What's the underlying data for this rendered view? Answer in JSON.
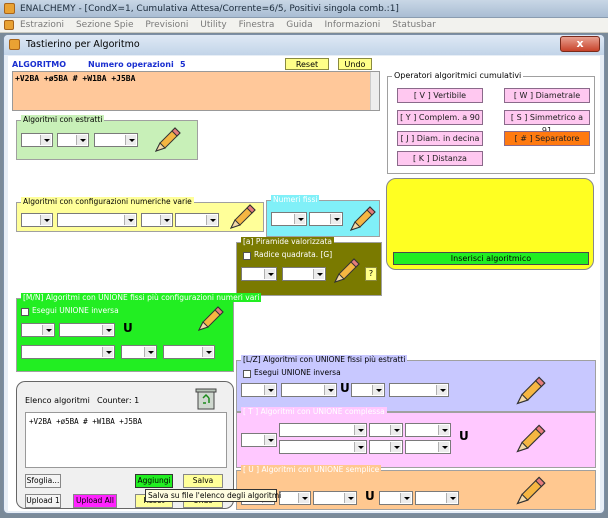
{
  "window": {
    "title": "ENALCHEMY - [CondX=1, Cumulativa Attesa/Corrente=6/5, Positivi singola comb.:1]",
    "menu": [
      "Estrazioni",
      "Sezione Spie",
      "Previsioni",
      "Utility",
      "Finestra",
      "Guida",
      "Informazioni",
      "Statusbar"
    ]
  },
  "dialog": {
    "title": "Tastierino per Algoritmo",
    "close_glyph": "x"
  },
  "algorithm": {
    "label": "ALGORITMO",
    "ops_label": "Numero operazioni",
    "ops_count": "5",
    "reset_label": "Reset",
    "undo_label": "Undo",
    "formula": "+V2BA +ø5BA # +W1BA +J5BA"
  },
  "operators": {
    "title": "Operatori algoritmici cumulativi",
    "buttons": [
      "[ V ] Vertibile",
      "[ W ] Diametrale",
      "[ Y ] Complem. a 90",
      "[ S ] Simmetrico  a 91",
      "[ J ] Diam. in decina",
      "[ # ] Separatore",
      "[ K ] Distanza"
    ]
  },
  "sections": {
    "estratti": "Algoritmi con estratti",
    "config": "Algoritmi con configurazioni numeriche varie",
    "fissi": "Numeri fissi",
    "piramide": "[a] Piramide valorizzata",
    "radice": "Radice quadrata. [G]",
    "question": "?",
    "mn": "[M/N] Algoritmi con UNIONE fissi più configurazioni numeri vari",
    "mn_check": "Esegui UNIONE inversa",
    "lz": "[L/Z] Algoritmi con UNIONE fissi più estratti",
    "lz_check": "Esegui UNIONE inversa",
    "t": "[ T ] Algoritmi con UNIONE complessa",
    "u": "[ U ] Algoritmi con UNIONE semplice",
    "u_letter": "U"
  },
  "insert": {
    "label": "Inserisci algoritmico"
  },
  "elenco": {
    "label": "Elenco algoritmi",
    "counter": "Counter: 1",
    "item": "+V2BA +ø5BA # +W1BA +J5BA",
    "sfoglia": "Sfoglia...",
    "aggiungi": "Aggiungi",
    "salva": "Salva",
    "upload1": "Upload 1",
    "upload_all": "Upload All",
    "reset": "Reset",
    "undo": "Undo",
    "tooltip": "Salva su file l'elenco degli algoritmi"
  },
  "colors": {
    "formula_bg": "#ffc89a",
    "estratti_bg": "#c8f0b8",
    "config_bg": "#ffff99",
    "fissi_bg": "#80f0f8",
    "piramide_bg": "#7a7a00",
    "mn_bg": "#22ee22",
    "lz_bg": "#c8c8ff",
    "t_bg": "#ffc8ff",
    "u_bg": "#ffc890",
    "yellow_panel": "#ffff22",
    "insert_green": "#22ee22",
    "separator_orange": "#ff7a10",
    "upload_all_magenta": "#ff22ff"
  }
}
